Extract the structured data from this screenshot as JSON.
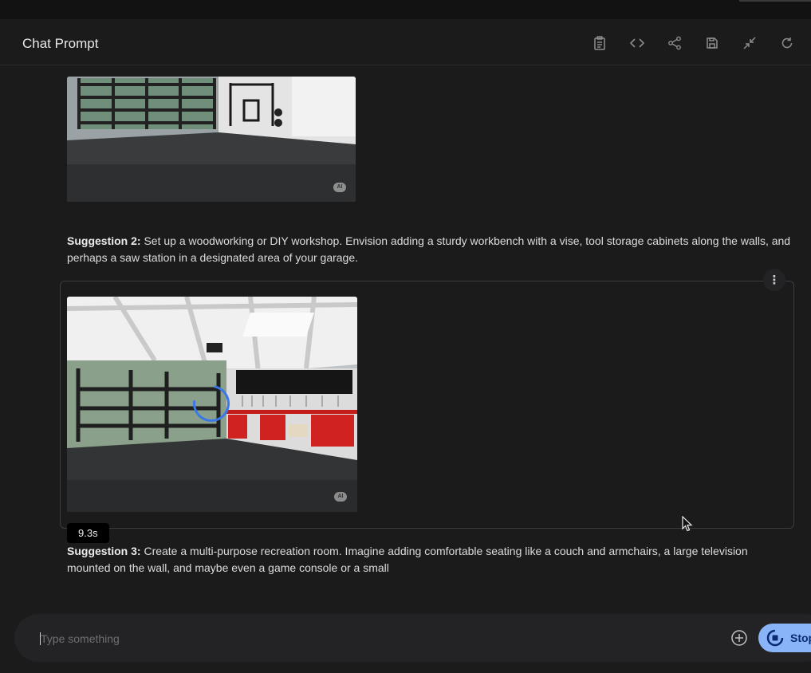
{
  "header": {
    "title": "Chat Prompt",
    "icons": [
      "clipboard-icon",
      "code-icon",
      "share-icon",
      "save-icon",
      "collapse-icon",
      "refresh-icon"
    ]
  },
  "images": {
    "ai_badge": "AI"
  },
  "suggestion2": {
    "label": "Suggestion 2:",
    "text": " Set up a woodworking or DIY workshop. Envision adding a sturdy workbench with a vise, tool storage cabinets along the walls, and perhaps a saw station in a designated area of your garage."
  },
  "suggestion3": {
    "label": "Suggestion 3:",
    "text": " Create a multi-purpose recreation room. Imagine adding comfortable seating like a couch and armchairs, a large television mounted on the wall, and maybe even a game console or a small"
  },
  "timer": "9.3s",
  "more_menu": "⋮",
  "input": {
    "placeholder": "Type something",
    "value": ""
  },
  "stop_button": {
    "label": "Stop"
  },
  "colors": {
    "background": "#1b1b1c",
    "accent": "#8ab4f8",
    "spinner": "#3b78e7"
  }
}
